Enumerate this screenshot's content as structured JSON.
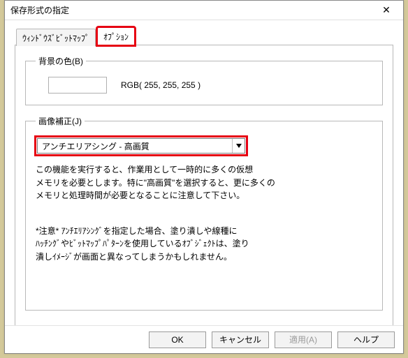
{
  "window": {
    "title": "保存形式の指定",
    "close": "✕"
  },
  "tabs": {
    "bitmap": "ｳｨﾝﾄﾞｳｽﾞﾋﾞｯﾄﾏｯﾌﾟ",
    "options": "ｵﾌﾟｼｮﾝ"
  },
  "background_group": {
    "legend": "背景の色(B)",
    "rgb_label": "RGB( 255, 255, 255 )",
    "swatch_color": "#ffffff"
  },
  "correction_group": {
    "legend": "画像補正(J)",
    "combo_value": "アンチエリアシング - 高画質",
    "desc_line1": "この機能を実行すると、作業用として一時的に多くの仮想",
    "desc_line2": "メモリを必要とします。特に\"高画質\"を選択すると、更に多くの",
    "desc_line3": "メモリと処理時間が必要となることに注意して下さい。",
    "note_line1": "*注意* ｱﾝﾁｴﾘｱｼﾝｸﾞを指定した場合、塗り潰しや線種に",
    "note_line2": "ﾊｯﾁﾝｸﾞやﾋﾞｯﾄﾏｯﾌﾟﾊﾟﾀｰﾝを使用しているｵﾌﾞｼﾞｪｸﾄは、塗り",
    "note_line3": "潰しｲﾒｰｼﾞが画面と異なってしまうかもしれません。"
  },
  "buttons": {
    "ok": "OK",
    "cancel": "キャンセル",
    "apply": "適用(A)",
    "help": "ヘルプ"
  }
}
